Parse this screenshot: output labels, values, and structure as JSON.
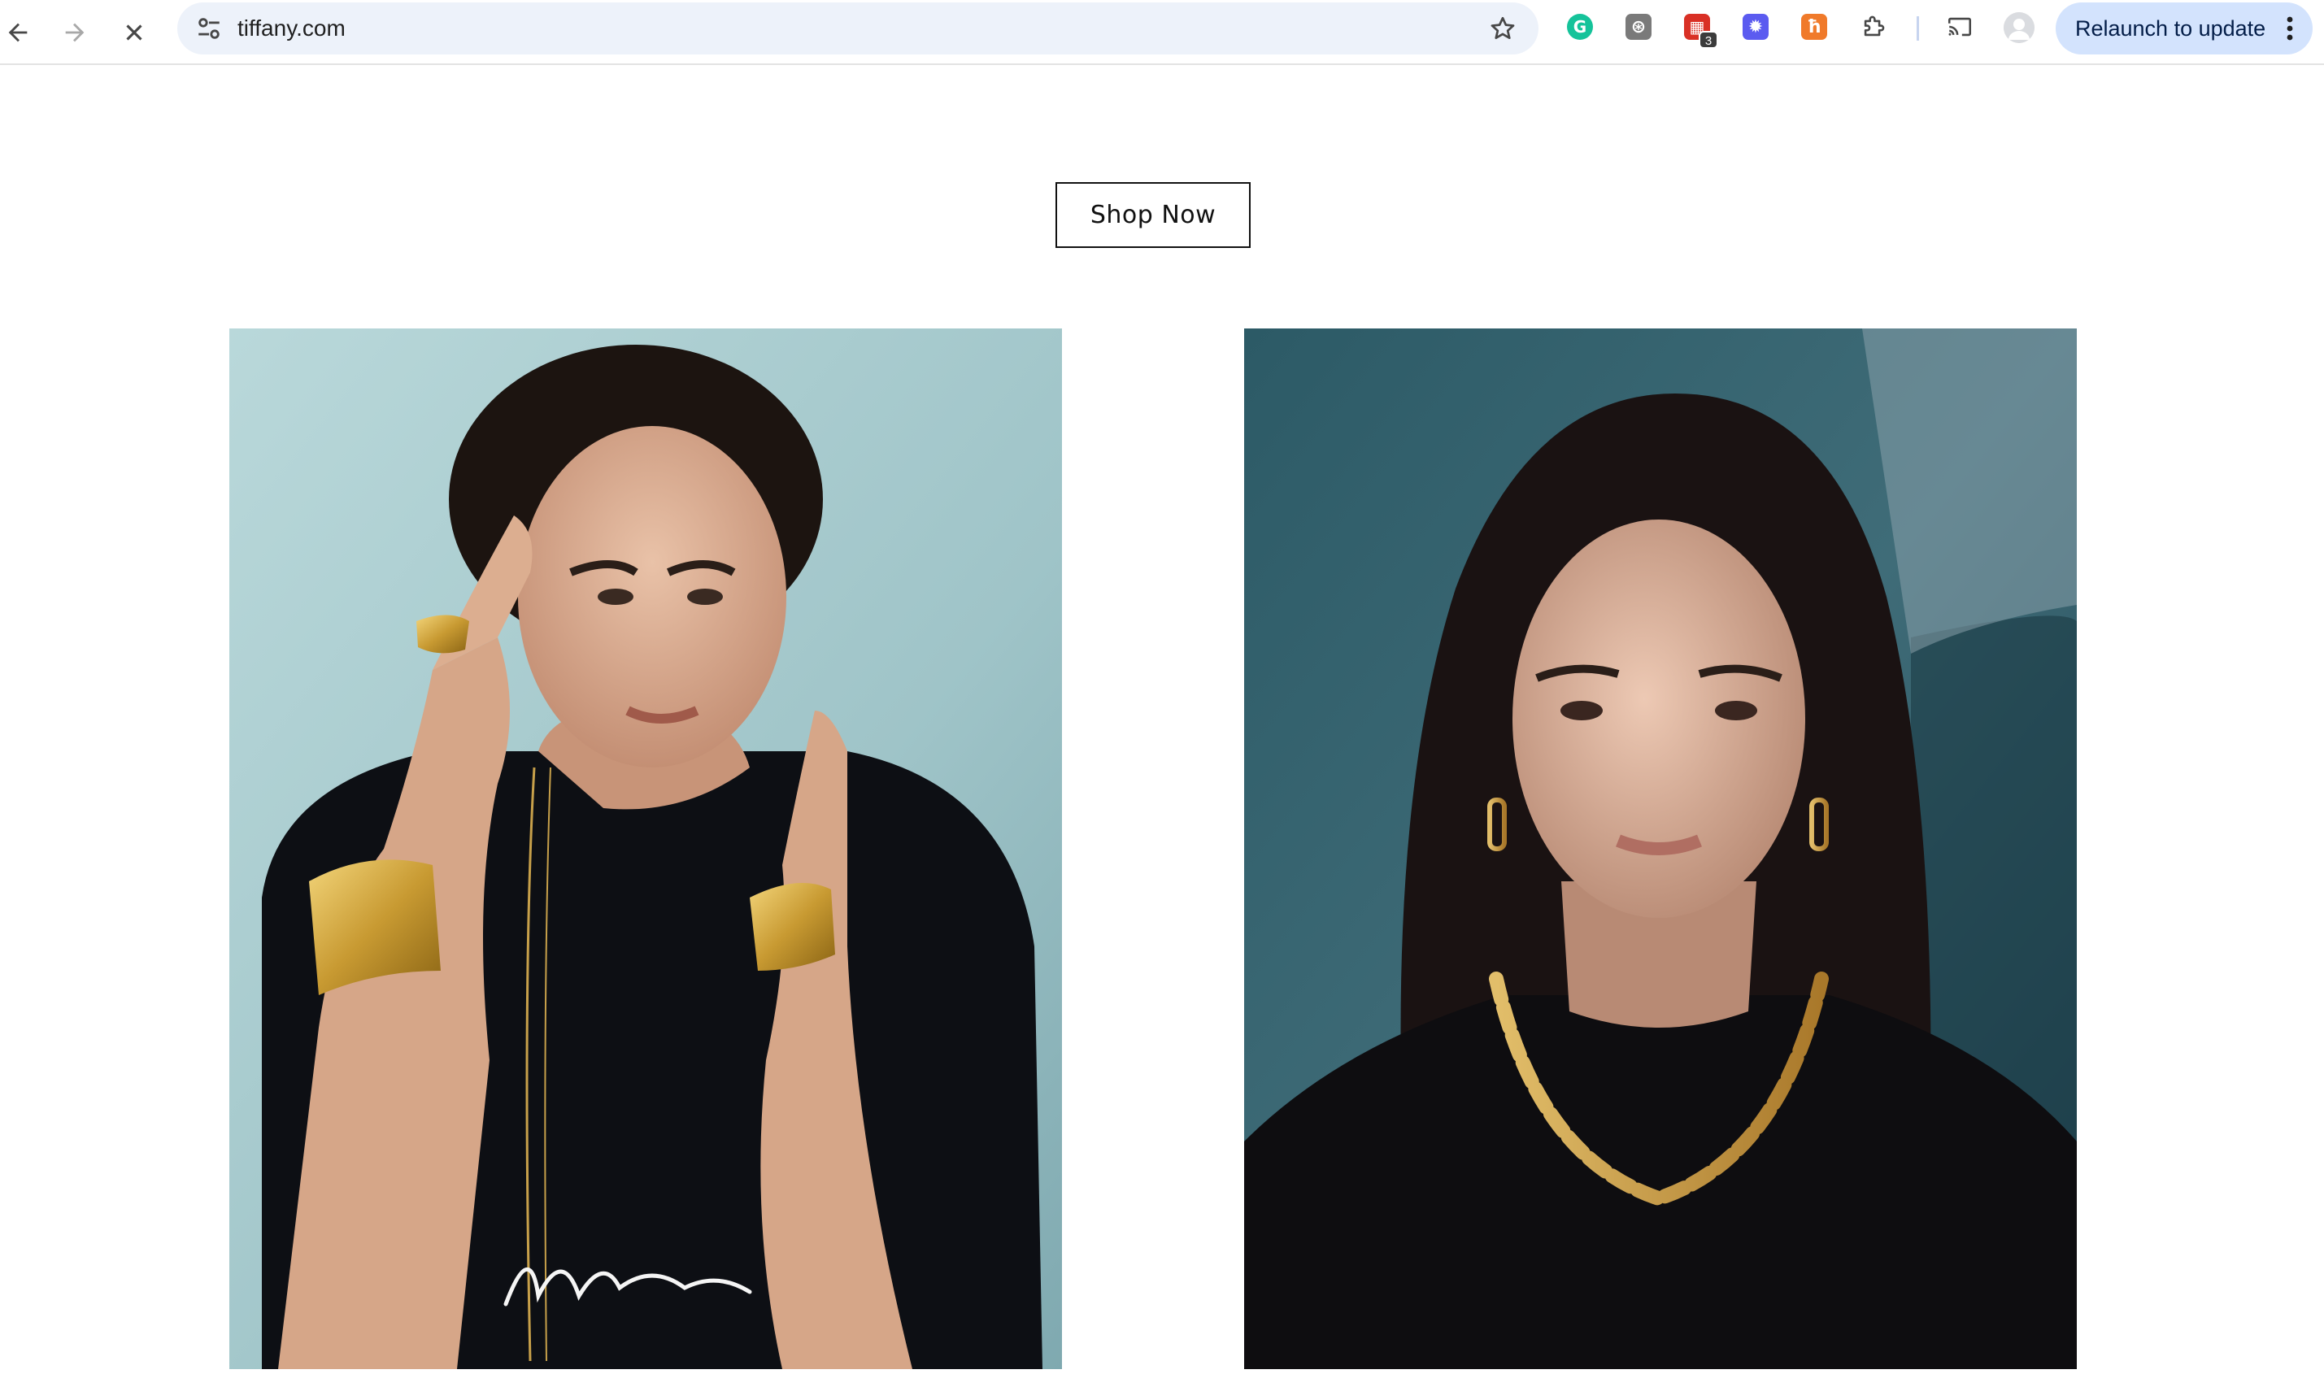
{
  "browser": {
    "url": "tiffany.com",
    "relaunch_label": "Relaunch to update",
    "extensions": [
      {
        "name": "grammarly-extension",
        "color": "#15c39a",
        "glyph": "G"
      },
      {
        "name": "dark-gray-extension",
        "color": "#7a7a7a",
        "glyph": "⊛"
      },
      {
        "name": "red-calendar-extension",
        "color": "#d93025",
        "glyph": "▦",
        "badge": "3"
      },
      {
        "name": "purple-extension",
        "color": "#5b5bf0",
        "glyph": "✹"
      },
      {
        "name": "orange-extension",
        "color": "#f07a2a",
        "glyph": "ħ"
      }
    ]
  },
  "page": {
    "cta_label": "Shop Now",
    "images": [
      {
        "name": "elsa-peretti-campaign-photo",
        "alt": "Model wearing gold bone cuffs and ring"
      },
      {
        "name": "hardwear-campaign-photo",
        "alt": "Model wearing gold link necklace and earrings"
      }
    ]
  },
  "colors": {
    "omnibox_bg": "#edf2fa",
    "relaunch_bg": "#d3e3fd",
    "cta_border": "#111111"
  }
}
